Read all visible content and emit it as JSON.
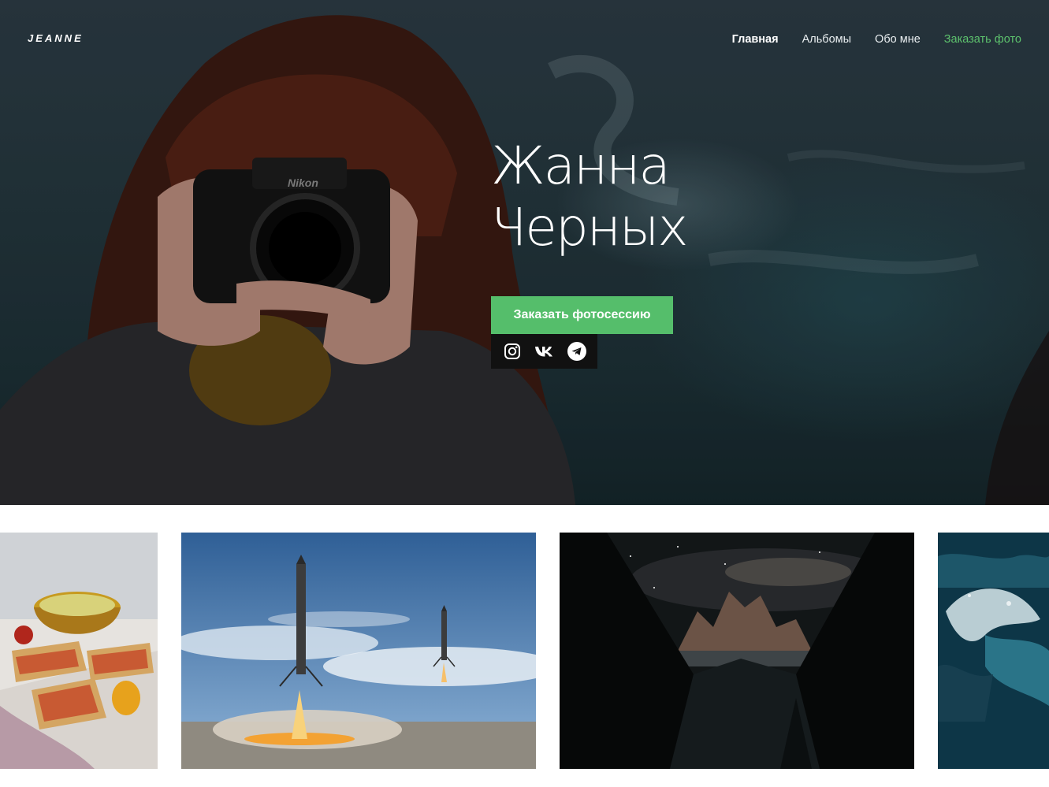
{
  "header": {
    "logo": "JEANNE",
    "nav": [
      {
        "label": "Главная",
        "active": true
      },
      {
        "label": "Альбомы"
      },
      {
        "label": "Обо мне"
      },
      {
        "label": "Заказать фото",
        "accent": true
      }
    ]
  },
  "hero": {
    "name_line1": "Жанна",
    "name_line2": "Черных",
    "cta_label": "Заказать фотосессию",
    "socials": [
      "instagram-icon",
      "vk-icon",
      "telegram-icon"
    ]
  },
  "gallery": {
    "items": [
      "food",
      "rocket-landing",
      "mountains-night",
      "ocean-wave"
    ]
  },
  "colors": {
    "accent": "#55be6b",
    "nav_accent": "#5dc26d",
    "social_bar": "#111111"
  }
}
